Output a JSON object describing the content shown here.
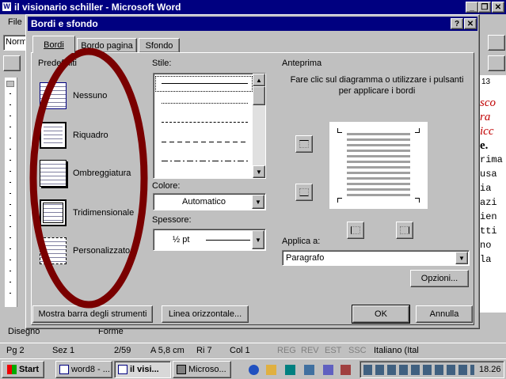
{
  "app": {
    "title": "il visionario schiller - Microsoft Word",
    "menu_file": "File",
    "font_box": "Norm"
  },
  "doc_right": {
    "num": "13",
    "lines": [
      "sco",
      "ra",
      "icc",
      "e.",
      "rima",
      "usa",
      "ia",
      "azi",
      "ien",
      "tti",
      "no",
      "la"
    ]
  },
  "draw_toolbar": {
    "draw": "Disegno",
    "shapes": "Forme"
  },
  "dialog": {
    "title": "Bordi e sfondo",
    "help": "?",
    "close": "✕",
    "tabs": [
      "Bordi",
      "Bordo pagina",
      "Sfondo"
    ],
    "presets_label": "Predefiniti",
    "presets": [
      "Nessuno",
      "Riquadro",
      "Ombreggiatura",
      "Tridimensionale",
      "Personalizzato"
    ],
    "style_label": "Stile:",
    "color_label": "Colore:",
    "color_value": "Automatico",
    "width_label": "Spessore:",
    "width_value": "½ pt",
    "preview_label": "Anteprima",
    "preview_hint": "Fare clic sul diagramma o utilizzare i pulsanti per applicare i bordi",
    "apply_label": "Applica a:",
    "apply_value": "Paragrafo",
    "options_button": "Opzioni...",
    "toolbar_button": "Mostra barra degli strumenti",
    "hline_button": "Linea orizzontale...",
    "ok_button": "OK",
    "cancel_button": "Annulla"
  },
  "status": {
    "page": "Pg 2",
    "section": "Sez 1",
    "pages": "2/59",
    "at": "A 5,8 cm",
    "line": "Ri 7",
    "col": "Col 1",
    "rec": "REG",
    "rev": "REV",
    "ext": "EST",
    "ovr": "SSC",
    "lang": "Italiano (Ital"
  },
  "taskbar": {
    "start": "Start",
    "tasks": [
      "word8 - ...",
      "il visi...",
      "Microso..."
    ],
    "clock": "18.26"
  },
  "colors": {
    "title_bar": "#000080",
    "annotation_ellipse": "#7a0000",
    "doc_red_text": "#c00000"
  }
}
